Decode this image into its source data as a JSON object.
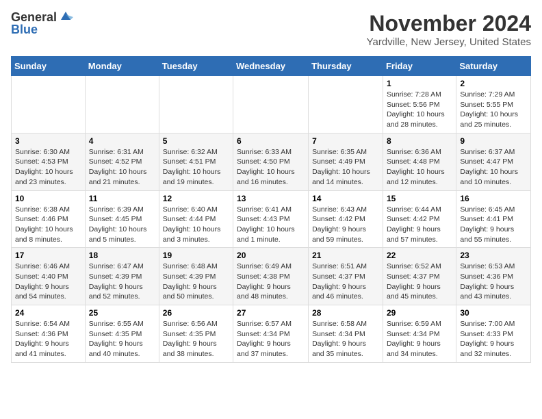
{
  "header": {
    "logo_general": "General",
    "logo_blue": "Blue",
    "month_title": "November 2024",
    "location": "Yardville, New Jersey, United States"
  },
  "days_of_week": [
    "Sunday",
    "Monday",
    "Tuesday",
    "Wednesday",
    "Thursday",
    "Friday",
    "Saturday"
  ],
  "weeks": [
    [
      {
        "day": "",
        "info": ""
      },
      {
        "day": "",
        "info": ""
      },
      {
        "day": "",
        "info": ""
      },
      {
        "day": "",
        "info": ""
      },
      {
        "day": "",
        "info": ""
      },
      {
        "day": "1",
        "info": "Sunrise: 7:28 AM\nSunset: 5:56 PM\nDaylight: 10 hours and 28 minutes."
      },
      {
        "day": "2",
        "info": "Sunrise: 7:29 AM\nSunset: 5:55 PM\nDaylight: 10 hours and 25 minutes."
      }
    ],
    [
      {
        "day": "3",
        "info": "Sunrise: 6:30 AM\nSunset: 4:53 PM\nDaylight: 10 hours and 23 minutes."
      },
      {
        "day": "4",
        "info": "Sunrise: 6:31 AM\nSunset: 4:52 PM\nDaylight: 10 hours and 21 minutes."
      },
      {
        "day": "5",
        "info": "Sunrise: 6:32 AM\nSunset: 4:51 PM\nDaylight: 10 hours and 19 minutes."
      },
      {
        "day": "6",
        "info": "Sunrise: 6:33 AM\nSunset: 4:50 PM\nDaylight: 10 hours and 16 minutes."
      },
      {
        "day": "7",
        "info": "Sunrise: 6:35 AM\nSunset: 4:49 PM\nDaylight: 10 hours and 14 minutes."
      },
      {
        "day": "8",
        "info": "Sunrise: 6:36 AM\nSunset: 4:48 PM\nDaylight: 10 hours and 12 minutes."
      },
      {
        "day": "9",
        "info": "Sunrise: 6:37 AM\nSunset: 4:47 PM\nDaylight: 10 hours and 10 minutes."
      }
    ],
    [
      {
        "day": "10",
        "info": "Sunrise: 6:38 AM\nSunset: 4:46 PM\nDaylight: 10 hours and 8 minutes."
      },
      {
        "day": "11",
        "info": "Sunrise: 6:39 AM\nSunset: 4:45 PM\nDaylight: 10 hours and 5 minutes."
      },
      {
        "day": "12",
        "info": "Sunrise: 6:40 AM\nSunset: 4:44 PM\nDaylight: 10 hours and 3 minutes."
      },
      {
        "day": "13",
        "info": "Sunrise: 6:41 AM\nSunset: 4:43 PM\nDaylight: 10 hours and 1 minute."
      },
      {
        "day": "14",
        "info": "Sunrise: 6:43 AM\nSunset: 4:42 PM\nDaylight: 9 hours and 59 minutes."
      },
      {
        "day": "15",
        "info": "Sunrise: 6:44 AM\nSunset: 4:42 PM\nDaylight: 9 hours and 57 minutes."
      },
      {
        "day": "16",
        "info": "Sunrise: 6:45 AM\nSunset: 4:41 PM\nDaylight: 9 hours and 55 minutes."
      }
    ],
    [
      {
        "day": "17",
        "info": "Sunrise: 6:46 AM\nSunset: 4:40 PM\nDaylight: 9 hours and 54 minutes."
      },
      {
        "day": "18",
        "info": "Sunrise: 6:47 AM\nSunset: 4:39 PM\nDaylight: 9 hours and 52 minutes."
      },
      {
        "day": "19",
        "info": "Sunrise: 6:48 AM\nSunset: 4:39 PM\nDaylight: 9 hours and 50 minutes."
      },
      {
        "day": "20",
        "info": "Sunrise: 6:49 AM\nSunset: 4:38 PM\nDaylight: 9 hours and 48 minutes."
      },
      {
        "day": "21",
        "info": "Sunrise: 6:51 AM\nSunset: 4:37 PM\nDaylight: 9 hours and 46 minutes."
      },
      {
        "day": "22",
        "info": "Sunrise: 6:52 AM\nSunset: 4:37 PM\nDaylight: 9 hours and 45 minutes."
      },
      {
        "day": "23",
        "info": "Sunrise: 6:53 AM\nSunset: 4:36 PM\nDaylight: 9 hours and 43 minutes."
      }
    ],
    [
      {
        "day": "24",
        "info": "Sunrise: 6:54 AM\nSunset: 4:36 PM\nDaylight: 9 hours and 41 minutes."
      },
      {
        "day": "25",
        "info": "Sunrise: 6:55 AM\nSunset: 4:35 PM\nDaylight: 9 hours and 40 minutes."
      },
      {
        "day": "26",
        "info": "Sunrise: 6:56 AM\nSunset: 4:35 PM\nDaylight: 9 hours and 38 minutes."
      },
      {
        "day": "27",
        "info": "Sunrise: 6:57 AM\nSunset: 4:34 PM\nDaylight: 9 hours and 37 minutes."
      },
      {
        "day": "28",
        "info": "Sunrise: 6:58 AM\nSunset: 4:34 PM\nDaylight: 9 hours and 35 minutes."
      },
      {
        "day": "29",
        "info": "Sunrise: 6:59 AM\nSunset: 4:34 PM\nDaylight: 9 hours and 34 minutes."
      },
      {
        "day": "30",
        "info": "Sunrise: 7:00 AM\nSunset: 4:33 PM\nDaylight: 9 hours and 32 minutes."
      }
    ]
  ]
}
